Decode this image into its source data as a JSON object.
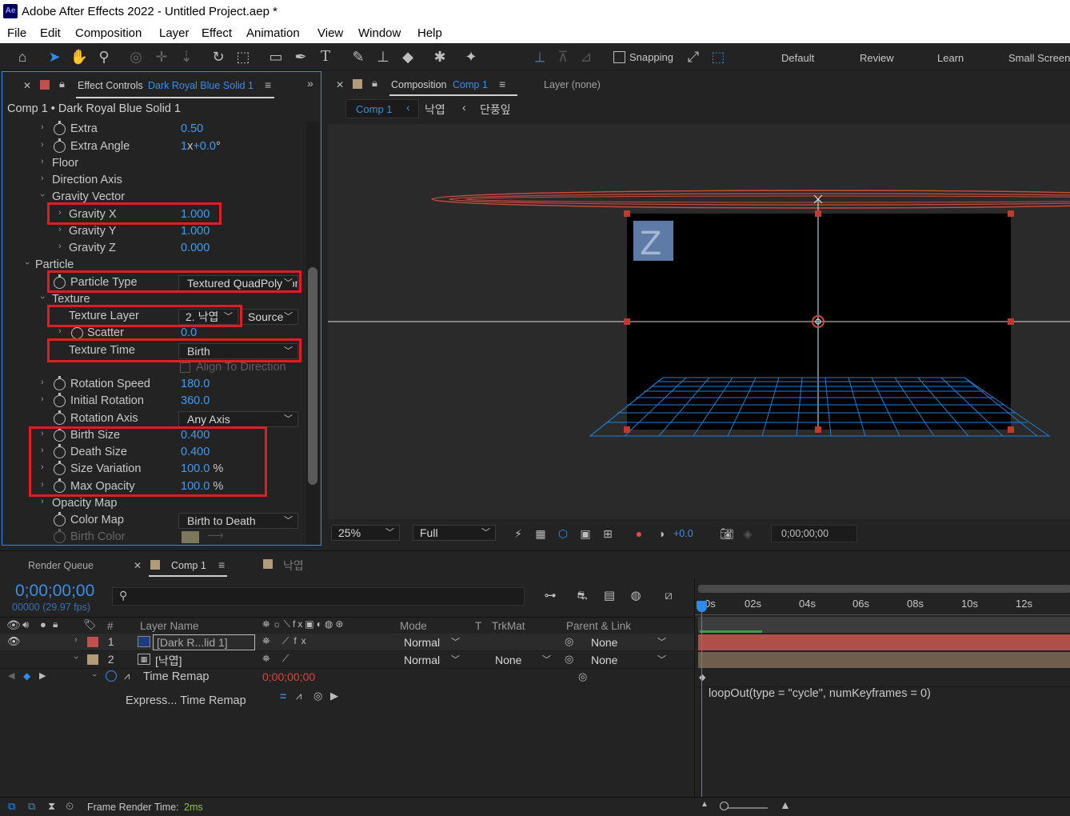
{
  "app": {
    "title": "Adobe After Effects 2022 - Untitled Project.aep *",
    "logo": "Ae"
  },
  "menu": [
    "File",
    "Edit",
    "Composition",
    "Layer",
    "Effect",
    "Animation",
    "View",
    "Window",
    "Help"
  ],
  "toolbar": {
    "snapping": "Snapping",
    "workspaces": [
      "Default",
      "Review",
      "Learn",
      "Small Screen"
    ]
  },
  "effect_controls": {
    "tab_label": "Effect Controls",
    "tab_layer": "Dark Royal Blue Solid 1",
    "header": "Comp 1 • Dark Royal Blue Solid 1",
    "props": {
      "extra": {
        "label": "Extra",
        "value": "0.50"
      },
      "extra_angle": {
        "label": "Extra Angle",
        "value_rev": "1",
        "value_x": "x",
        "value_deg": "+0.0",
        "deg": "°"
      },
      "floor": "Floor",
      "direction_axis": "Direction Axis",
      "gravity_vector": "Gravity Vector",
      "gravity_x": {
        "label": "Gravity X",
        "value": "1.000"
      },
      "gravity_y": {
        "label": "Gravity Y",
        "value": "1.000"
      },
      "gravity_z": {
        "label": "Gravity Z",
        "value": "0.000"
      },
      "particle": "Particle",
      "particle_type": {
        "label": "Particle Type",
        "value": "Textured QuadPolygon"
      },
      "texture": "Texture",
      "texture_layer": {
        "label": "Texture Layer",
        "value": "2. 낙엽",
        "source": "Source"
      },
      "scatter": {
        "label": "Scatter",
        "value": "0.0"
      },
      "texture_time": {
        "label": "Texture Time",
        "value": "Birth"
      },
      "align_direction": "Align To Direction",
      "rotation_speed": {
        "label": "Rotation Speed",
        "value": "180.0"
      },
      "initial_rotation": {
        "label": "Initial Rotation",
        "value": "360.0"
      },
      "rotation_axis": {
        "label": "Rotation Axis",
        "value": "Any Axis"
      },
      "birth_size": {
        "label": "Birth Size",
        "value": "0.400"
      },
      "death_size": {
        "label": "Death Size",
        "value": "0.400"
      },
      "size_variation": {
        "label": "Size Variation",
        "value": "100.0",
        "unit": "%"
      },
      "max_opacity": {
        "label": "Max Opacity",
        "value": "100.0",
        "unit": "%"
      },
      "opacity_map": "Opacity Map",
      "color_map": {
        "label": "Color Map",
        "value": "Birth to Death"
      },
      "birth_color": {
        "label": "Birth Color",
        "color": "#fff7b0"
      }
    }
  },
  "composition": {
    "tab_label": "Composition",
    "tab_comp": "Comp 1",
    "layer_tab": "Layer (none)",
    "breadcrumb": [
      "Comp 1",
      "낙엽",
      "단풍잎"
    ],
    "zoom": "25%",
    "resolution": "Full",
    "exposure": "+0.0",
    "timecode": "0;00;00;00"
  },
  "timeline": {
    "tabs": {
      "render_queue": "Render Queue",
      "comp1": "Comp 1",
      "leaf": "낙엽"
    },
    "timecode": "0;00;00;00",
    "frames_fps": "00000 (29.97 fps)",
    "search_placeholder": "",
    "headers": {
      "num": "#",
      "layer_name": "Layer Name",
      "mode": "Mode",
      "t": "T",
      "trkmat": "TrkMat",
      "parent": "Parent & Link"
    },
    "ruler": [
      "0s",
      "02s",
      "04s",
      "06s",
      "08s",
      "10s",
      "12s"
    ],
    "layers": [
      {
        "num": "1",
        "name": "[Dark R...lid 1]",
        "mode": "Normal",
        "trkmat": "",
        "parent": "None",
        "color": "#c0504d"
      },
      {
        "num": "2",
        "name": "[낙엽]",
        "mode": "Normal",
        "trkmat": "None",
        "parent": "None",
        "color": "#b39b7a"
      }
    ],
    "time_remap": {
      "label": "Time Remap",
      "value": "0;00;00;00"
    },
    "expression": {
      "label": "Express... Time Remap",
      "code": "loopOut(type = \"cycle\", numKeyframes = 0)"
    }
  },
  "status": {
    "label": "Frame Render Time:",
    "value": "2ms"
  }
}
